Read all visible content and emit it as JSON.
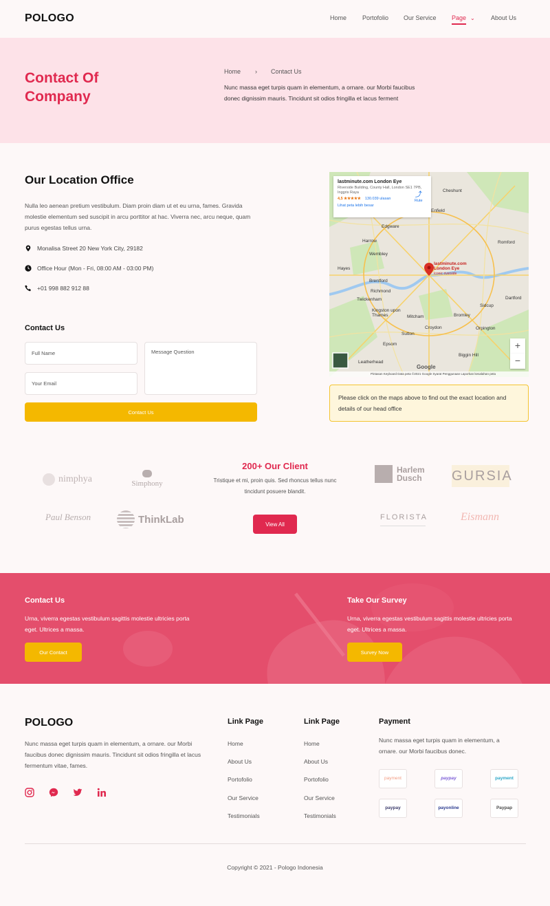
{
  "brand": "POLOGO",
  "nav": {
    "home": "Home",
    "portfolio": "Portofolio",
    "service": "Our Service",
    "page": "Page",
    "about": "About Us"
  },
  "hero": {
    "title": "Contact Of Company",
    "breadcrumb_home": "Home",
    "breadcrumb_sep": "›",
    "breadcrumb_current": "Contact Us",
    "text": "Nunc massa eget turpis quam in elementum, a ornare. our Morbi faucibus donec dignissim mauris. Tincidunt sit odios fringilla et lacus ferment"
  },
  "location": {
    "title": "Our Location Office",
    "text": "Nulla leo aenean pretium vestibulum. Diam proin diam ut et eu urna, fames. Gravida molestie elementum sed suscipit in arcu porttitor at hac. Viverra nec, arcu neque, quam purus egestas tellus urna.",
    "address": "Monalisa Street 20 New York City, 29182",
    "hours": "Office Hour (Mon - Fri, 08:00 AM - 03:00 PM)",
    "phone": "+01 998 882 912 88",
    "icons": [
      "map-pin-icon",
      "clock-icon",
      "phone-icon"
    ]
  },
  "contact_form": {
    "title": "Contact Us",
    "name_placeholder": "Full Name",
    "email_placeholder": "Your Email",
    "message_placeholder": "Message Question",
    "submit_label": "Contact Us"
  },
  "map": {
    "place_name": "lastminute.com London Eye",
    "place_address": "Riverside Building, County Hall, London SE1 7PB, Inggris Raya",
    "rating": "4,5 ★★★★★",
    "reviews": "130.039 ulasan",
    "larger_link": "Lihat peta lebih besar",
    "route_label": "Rute",
    "pin_label": "lastminute.com London Eye",
    "pin_sublabel": "Iconic riverside",
    "labels": [
      "Cheshunt",
      "Enfield",
      "Edgware",
      "Harrow",
      "Wembley",
      "Romford",
      "Hayes",
      "Brentford",
      "Twickenham",
      "Richmond",
      "Kingston upon Thames",
      "Mitcham",
      "Bromley",
      "Sidcup",
      "Dartford",
      "Croydon",
      "Sutton",
      "Epsom",
      "Leatherhead",
      "Orpington",
      "Biggin Hill"
    ],
    "footer": "Pintasan Keyboard   Data peta ©2021 Google   Syarat Penggunaan   Laporkan kesalahan peta",
    "google": "Google",
    "zoom_in": "+",
    "zoom_out": "−",
    "note": "Please click on the maps above to find out the exact location and details of our head office"
  },
  "clients": {
    "title": "200+  Our Client",
    "text": "Tristique et mi, proin quis. Sed rhoncus tellus nunc tincidunt posuere blandit.",
    "button": "View All",
    "logos": [
      "nimphya",
      "Simphony",
      "Paul Benson",
      "ThinkLab",
      "Harlem Dusch",
      "GURSIA",
      "FLORISTA",
      "Eismann"
    ]
  },
  "banner": {
    "left_title": "Contact Us",
    "left_text": "Urna, viverra egestas vestibulum sagittis molestie ultricies porta eget. Ultrices a massa.",
    "left_button": "Our Contact",
    "right_title": "Take Our Survey",
    "right_text": "Urna, viverra egestas vestibulum sagittis molestie ultricies porta eget. Ultrices a massa.",
    "right_button": "Survey Now"
  },
  "footer": {
    "brand": "POLOGO",
    "text": "Nunc massa eget turpis quam in elementum, a ornare. our Morbi faucibus donec dignissim mauris. Tincidunt sit odios fringilla et lacus fermentum vitae, fames.",
    "social": [
      "instagram-icon",
      "messenger-icon",
      "twitter-icon",
      "linkedin-icon"
    ],
    "link_col1_title": "Link Page",
    "link_col1": [
      "Home",
      "About Us",
      "Portofolio",
      "Our Service",
      "Testimonials"
    ],
    "link_col2_title": "Link Page",
    "link_col2": [
      "Home",
      "About Us",
      "Portofolio",
      "Our Service",
      "Testimonials"
    ],
    "payment_title": "Payment",
    "payment_text": "Nunc massa eget turpis quam in elementum, a ornare. our Morbi faucibus donec.",
    "payments": [
      "payment",
      "paypay",
      "payment",
      "paypay",
      "payonline",
      "Paypap"
    ],
    "copyright": "Copyright © 2021 - Pologo Indonesia"
  },
  "colors": {
    "accent": "#e0294f",
    "yellow": "#f4b800",
    "hero_bg": "#fde2e8",
    "banner_bg": "#e44e6c"
  }
}
